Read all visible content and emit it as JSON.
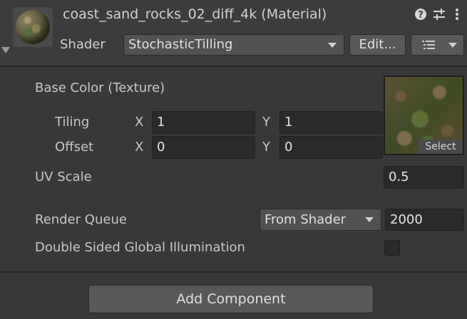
{
  "header": {
    "title": "coast_sand_rocks_02_diff_4k (Material)",
    "icons": [
      "help-icon",
      "preset-sliders-icon",
      "more-options-icon"
    ],
    "shader_label": "Shader",
    "shader_value": "StochasticTilling",
    "edit_button": "Edit...",
    "list_icon": "list-icon"
  },
  "properties": {
    "base_color_label": "Base Color (Texture)",
    "tiling": {
      "label": "Tiling",
      "x_label": "X",
      "x": "1",
      "y_label": "Y",
      "y": "1"
    },
    "offset": {
      "label": "Offset",
      "x_label": "X",
      "x": "0",
      "y_label": "Y",
      "y": "0"
    },
    "texture_select": "Select",
    "uv_scale": {
      "label": "UV Scale",
      "value": "0.5"
    },
    "render_queue": {
      "label": "Render Queue",
      "mode": "From Shader",
      "value": "2000"
    },
    "double_sided_gi": {
      "label": "Double Sided Global Illumination",
      "checked": false
    }
  },
  "footer": {
    "add_component": "Add Component"
  },
  "colors": {
    "panel_bg": "#383838",
    "header_bg": "#3c3c3c",
    "field_bg": "#2a2a2a",
    "button_bg": "#585858"
  }
}
